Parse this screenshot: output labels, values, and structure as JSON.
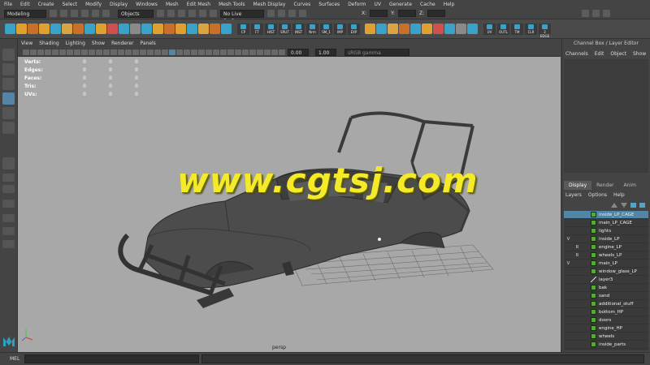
{
  "menubar": [
    "File",
    "Edit",
    "Create",
    "Select",
    "Modify",
    "Display",
    "Windows",
    "Mesh",
    "Edit Mesh",
    "Mesh Tools",
    "Mesh Display",
    "Curves",
    "Surfaces",
    "Deform",
    "UV",
    "Generate",
    "Cache",
    "Help"
  ],
  "statusline": {
    "mode": "Modeling",
    "selection_mode": "Objects",
    "live_surface": "No Live Surface",
    "x_label": "X:",
    "y_label": "Y:",
    "z_label": "Z:"
  },
  "shelf": {
    "labeled_buttons": [
      "CP",
      "FT",
      "HIST",
      "SPLIT",
      "INST",
      "Nrm",
      "SM_1",
      "IMP",
      "EXP",
      "UV",
      "OUTL",
      "TM",
      "CLR",
      "2 EDGE"
    ]
  },
  "viewport": {
    "menu": [
      "View",
      "Shading",
      "Lighting",
      "Show",
      "Renderer",
      "Panels"
    ],
    "field_a": "0.00",
    "field_b": "1.00",
    "color_space": "sRGB gamma",
    "hud": [
      {
        "label": "Verts:",
        "values": [
          "0",
          "0",
          "0"
        ]
      },
      {
        "label": "Edges:",
        "values": [
          "0",
          "0",
          "0"
        ]
      },
      {
        "label": "Faces:",
        "values": [
          "0",
          "0",
          "0"
        ]
      },
      {
        "label": "Tris:",
        "values": [
          "0",
          "0",
          "0"
        ]
      },
      {
        "label": "UVs:",
        "values": [
          "0",
          "0",
          "0"
        ]
      }
    ],
    "camera": "persp",
    "watermark": "www.cgtsj.com"
  },
  "channel_box": {
    "title": "Channel Box / Layer Editor",
    "menu": [
      "Channels",
      "Edit",
      "Object",
      "Show"
    ]
  },
  "layer_editor": {
    "tabs": [
      "Display",
      "Render",
      "Anim"
    ],
    "menu": [
      "Layers",
      "Options",
      "Help"
    ],
    "layers": [
      {
        "name": "inside_LP_CAGE",
        "v": "",
        "r": "",
        "color": "#56a83a",
        "selected": true
      },
      {
        "name": "main_LP_CAGE",
        "v": "",
        "r": "",
        "color": "#56a83a"
      },
      {
        "name": "lights",
        "v": "",
        "r": "",
        "color": "#56a83a"
      },
      {
        "name": "inside_LP",
        "v": "V",
        "r": "",
        "color": "#56a83a"
      },
      {
        "name": "engine_LP",
        "v": "",
        "r": "R",
        "color": "#56a83a"
      },
      {
        "name": "wheels_LP",
        "v": "",
        "r": "R",
        "color": "#56a83a"
      },
      {
        "name": "main_LP",
        "v": "V",
        "r": "",
        "color": "#56a83a"
      },
      {
        "name": "window_glass_LP",
        "v": "",
        "r": "",
        "color": "#56a83a"
      },
      {
        "name": "layer3",
        "v": "",
        "r": "",
        "color": "none"
      },
      {
        "name": "bak",
        "v": "",
        "r": "",
        "color": "#56a83a"
      },
      {
        "name": "sand",
        "v": "",
        "r": "",
        "color": "#56a83a"
      },
      {
        "name": "additional_stuff",
        "v": "",
        "r": "",
        "color": "#56a83a"
      },
      {
        "name": "bottom_HP",
        "v": "",
        "r": "",
        "color": "#56a83a"
      },
      {
        "name": "doors",
        "v": "",
        "r": "",
        "color": "#56a83a"
      },
      {
        "name": "engine_HP",
        "v": "",
        "r": "",
        "color": "#56a83a"
      },
      {
        "name": "wheels",
        "v": "",
        "r": "",
        "color": "#56a83a"
      },
      {
        "name": "inside_parts",
        "v": "",
        "r": "",
        "color": "#56a83a"
      }
    ]
  },
  "command_line": {
    "label": "MEL"
  }
}
